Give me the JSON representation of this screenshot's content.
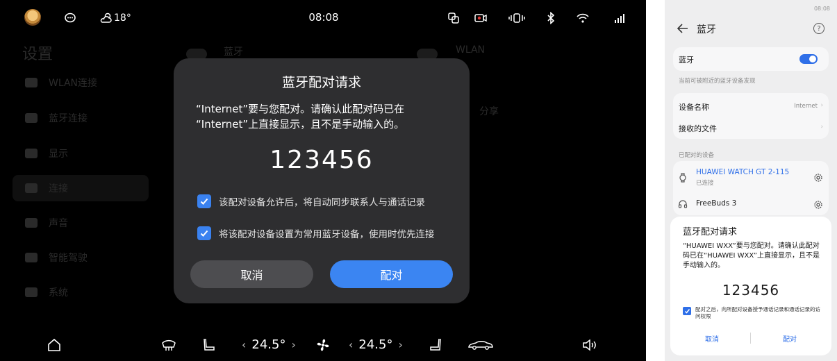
{
  "car": {
    "status": {
      "weather_temp": "18°",
      "time": "08:08"
    },
    "background": {
      "title": "设置",
      "menu": [
        "WLAN连接",
        "蓝牙连接",
        "显示",
        "连接",
        "声音",
        "智能驾驶",
        "系统"
      ],
      "bluetooth_label": "蓝牙",
      "wlan_label": "WLAN",
      "share_label": "分享"
    },
    "dialog": {
      "title": "蓝牙配对请求",
      "message_line1": "“Internet”要与您配对。请确认此配对码已在",
      "message_line2": "“Internet”上直接显示，且不是手动输入的。",
      "code": "123456",
      "check1": "该配对设备允许后，将自动同步联系人与通话记录",
      "check2": "将该配对设备设置为常用蓝牙设备，使用时优先连接",
      "cancel": "取消",
      "pair": "配对"
    },
    "dock": {
      "temp_left": "24.5°",
      "temp_right": "24.5°"
    },
    "colors": {
      "accent": "#3b85f2",
      "dialog_bg": "#2e2e30",
      "cancel_bg": "#4d4d50"
    }
  },
  "phone": {
    "status_time": "08:08",
    "title": "蓝牙",
    "bluetooth_label": "蓝牙",
    "discoverable_note": "当前可被附近的蓝牙设备发现",
    "device_name_label": "设备名称",
    "device_name_value": "Internet",
    "received_files": "接收的文件",
    "paired_header": "已配对的设备",
    "paired": [
      {
        "name": "HUAWEI WATCH GT 2-115",
        "status": "已连接",
        "icon": "watch-icon"
      },
      {
        "name": "FreeBuds 3",
        "status": "",
        "icon": "headphones-icon"
      }
    ],
    "sheet": {
      "title": "蓝牙配对请求",
      "message": "“HUAWEI WXX”要与您配对。请确认此配对码已在“HUAWEI WXX”上直接显示，且不是手动输入的。",
      "code": "123456",
      "check": "配对之后，向所配对设备授予通话记录和通话记录的访问权限",
      "cancel": "取消",
      "pair": "配对"
    },
    "colors": {
      "accent": "#2f6fe8"
    }
  }
}
